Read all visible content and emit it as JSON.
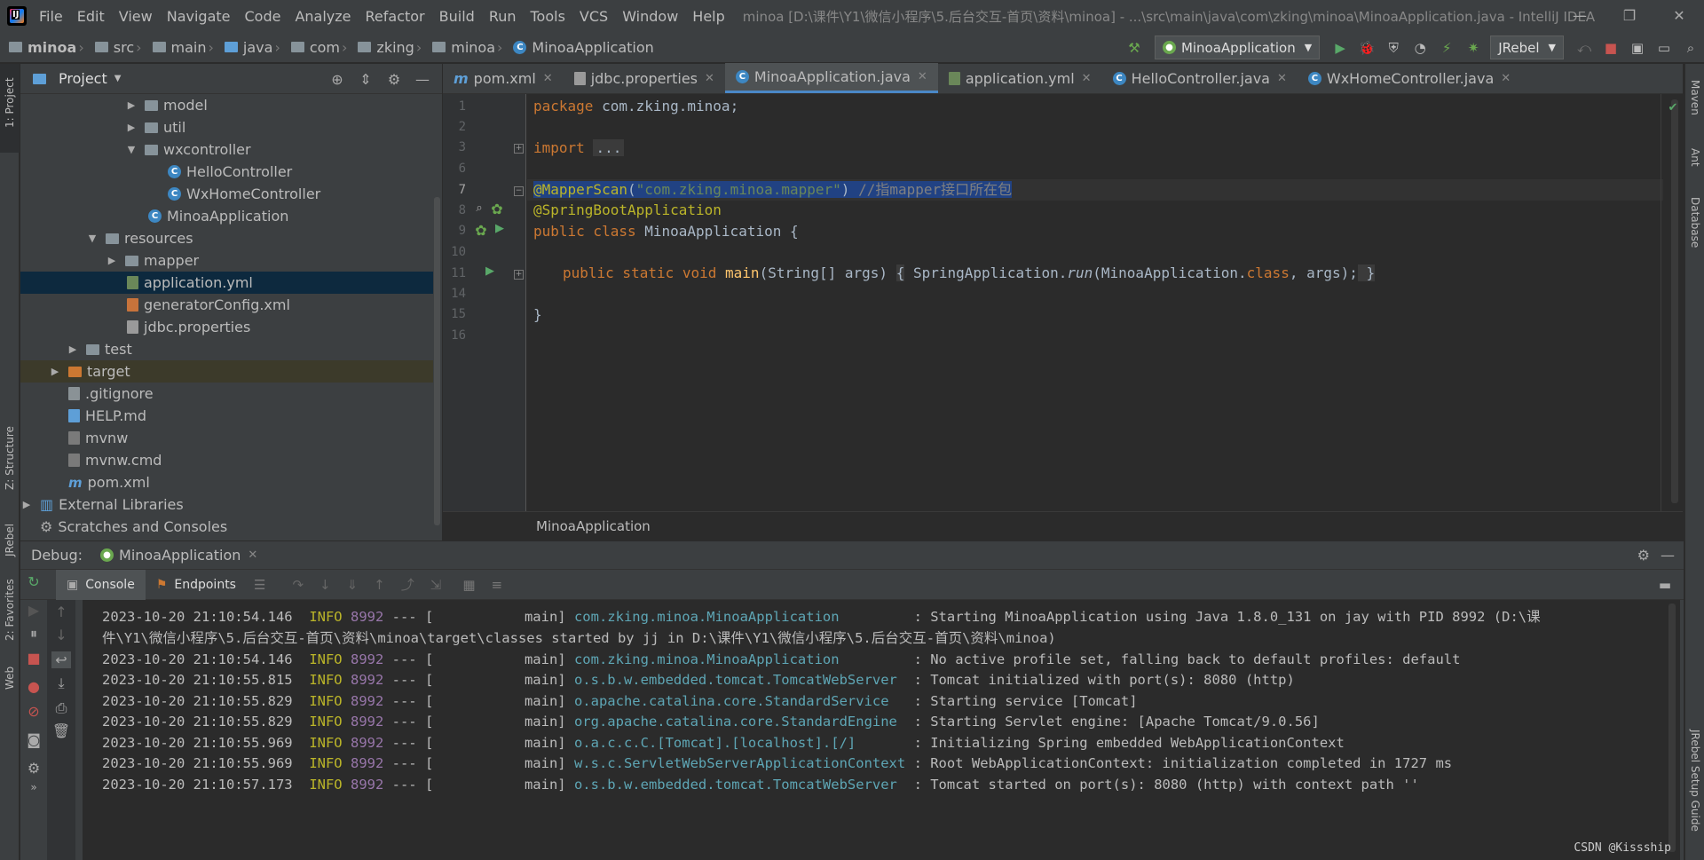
{
  "menubar": {
    "items": [
      "File",
      "Edit",
      "View",
      "Navigate",
      "Code",
      "Analyze",
      "Refactor",
      "Build",
      "Run",
      "Tools",
      "VCS",
      "Window",
      "Help"
    ],
    "title": "minoa [D:\\课件\\Y1\\微信小程序\\5.后台交互-首页\\资料\\minoa] - ...\\src\\main\\java\\com\\zking\\minoa\\MinoaApplication.java - IntelliJ IDEA"
  },
  "breadcrumb": [
    "minoa",
    "src",
    "main",
    "java",
    "com",
    "zking",
    "minoa",
    "MinoaApplication"
  ],
  "toolbar": {
    "run_config": "MinoaApplication",
    "jrebel": "JRebel"
  },
  "project_panel": {
    "title": "Project",
    "tree": [
      {
        "label": "model",
        "type": "folder",
        "arrow": "▶"
      },
      {
        "label": "util",
        "type": "folder",
        "arrow": "▶"
      },
      {
        "label": "wxcontroller",
        "type": "folder",
        "arrow": "▼"
      },
      {
        "label": "HelloController",
        "type": "class"
      },
      {
        "label": "WxHomeController",
        "type": "class"
      },
      {
        "label": "MinoaApplication",
        "type": "class"
      },
      {
        "label": "resources",
        "type": "folder",
        "arrow": "▼"
      },
      {
        "label": "mapper",
        "type": "folder",
        "arrow": "▶"
      },
      {
        "label": "application.yml",
        "type": "yml"
      },
      {
        "label": "generatorConfig.xml",
        "type": "xml"
      },
      {
        "label": "jdbc.properties",
        "type": "prop"
      },
      {
        "label": "test",
        "type": "folder",
        "arrow": "▶"
      },
      {
        "label": "target",
        "type": "folder-orange",
        "arrow": "▶"
      },
      {
        "label": ".gitignore",
        "type": "file"
      },
      {
        "label": "HELP.md",
        "type": "md"
      },
      {
        "label": "mvnw",
        "type": "mvn"
      },
      {
        "label": "mvnw.cmd",
        "type": "mvn"
      },
      {
        "label": "pom.xml",
        "type": "pom"
      },
      {
        "label": "External Libraries",
        "type": "lib",
        "arrow": "▶"
      },
      {
        "label": "Scratches and Consoles",
        "type": "scratch"
      }
    ]
  },
  "editor": {
    "tabs": [
      "pom.xml",
      "jdbc.properties",
      "MinoaApplication.java",
      "application.yml",
      "HelloController.java",
      "WxHomeController.java"
    ],
    "active_tab": "MinoaApplication.java",
    "line_numbers": [
      "1",
      "2",
      "3",
      "6",
      "7",
      "8",
      "9",
      "10",
      "11",
      "14",
      "15",
      "16"
    ],
    "code": {
      "l1_kw": "package",
      "l1_rest": " com.zking.minoa;",
      "l3_kw": "import",
      "l3_fold": "...",
      "l7_ann": "@MapperScan",
      "l7_p1": "(",
      "l7_str": "\"com.zking.minoa.mapper\"",
      "l7_p2": ") ",
      "l7_cmt": "//指mapper接口所在包",
      "l8_ann": "@SpringBootApplication",
      "l9_kw": "public class",
      "l9_rest": " MinoaApplication {",
      "l11_kw": "public static void",
      "l11_fn": "main",
      "l11_args": "(String[] args) ",
      "l11_b1": "{",
      "l11_call1": " SpringApplication.",
      "l11_run": "run",
      "l11_call2": "(MinoaApplication.",
      "l11_cls": "class",
      "l11_call3": ", args);",
      "l11_b2": " }",
      "l15": "}"
    },
    "breadcrumb": "MinoaApplication"
  },
  "debug": {
    "label": "Debug:",
    "session": "MinoaApplication",
    "tab_console": "Console",
    "tab_endpoints": "Endpoints",
    "logs": [
      {
        "ts": "2023-10-20 21:10:54.146",
        "lvl": "INFO",
        "pid": "8992",
        "mid": " --- [           main] ",
        "cls": "com.zking.minoa.MinoaApplication        ",
        "msg": " : Starting MinoaApplication using Java 1.8.0_131 on jay with PID 8992 (D:\\课"
      },
      {
        "ts": "",
        "lvl": "",
        "pid": "",
        "mid": "",
        "cls": "",
        "msg": "件\\Y1\\微信小程序\\5.后台交互-首页\\资料\\minoa\\target\\classes started by jj in D:\\课件\\Y1\\微信小程序\\5.后台交互-首页\\资料\\minoa)"
      },
      {
        "ts": "2023-10-20 21:10:54.146",
        "lvl": "INFO",
        "pid": "8992",
        "mid": " --- [           main] ",
        "cls": "com.zking.minoa.MinoaApplication        ",
        "msg": " : No active profile set, falling back to default profiles: default"
      },
      {
        "ts": "2023-10-20 21:10:55.815",
        "lvl": "INFO",
        "pid": "8992",
        "mid": " --- [           main] ",
        "cls": "o.s.b.w.embedded.tomcat.TomcatWebServer ",
        "msg": " : Tomcat initialized with port(s): 8080 (http)"
      },
      {
        "ts": "2023-10-20 21:10:55.829",
        "lvl": "INFO",
        "pid": "8992",
        "mid": " --- [           main] ",
        "cls": "o.apache.catalina.core.StandardService  ",
        "msg": " : Starting service [Tomcat]"
      },
      {
        "ts": "2023-10-20 21:10:55.829",
        "lvl": "INFO",
        "pid": "8992",
        "mid": " --- [           main] ",
        "cls": "org.apache.catalina.core.StandardEngine ",
        "msg": " : Starting Servlet engine: [Apache Tomcat/9.0.56]"
      },
      {
        "ts": "2023-10-20 21:10:55.969",
        "lvl": "INFO",
        "pid": "8992",
        "mid": " --- [           main] ",
        "cls": "o.a.c.c.C.[Tomcat].[localhost].[/]      ",
        "msg": " : Initializing Spring embedded WebApplicationContext"
      },
      {
        "ts": "2023-10-20 21:10:55.969",
        "lvl": "INFO",
        "pid": "8992",
        "mid": " --- [           main] ",
        "cls": "w.s.c.ServletWebServerApplicationContext",
        "msg": " : Root WebApplicationContext: initialization completed in 1727 ms"
      },
      {
        "ts": "2023-10-20 21:10:57.173",
        "lvl": "INFO",
        "pid": "8992",
        "mid": " --- [           main] ",
        "cls": "o.s.b.w.embedded.tomcat.TomcatWebServer ",
        "msg": " : Tomcat started on port(s): 8080 (http) with context path ''"
      }
    ]
  },
  "side_tabs": {
    "left_top": "1: Project",
    "left_structure": "Z: Structure",
    "left_jrebel": "JRebel",
    "left_favorites": "2: Favorites",
    "left_web": "Web",
    "right_maven": "Maven",
    "right_ant": "Ant",
    "right_database": "Database",
    "right_jrebel_guide": "JRebel Setup Guide"
  },
  "watermark": "CSDN @Kissship"
}
